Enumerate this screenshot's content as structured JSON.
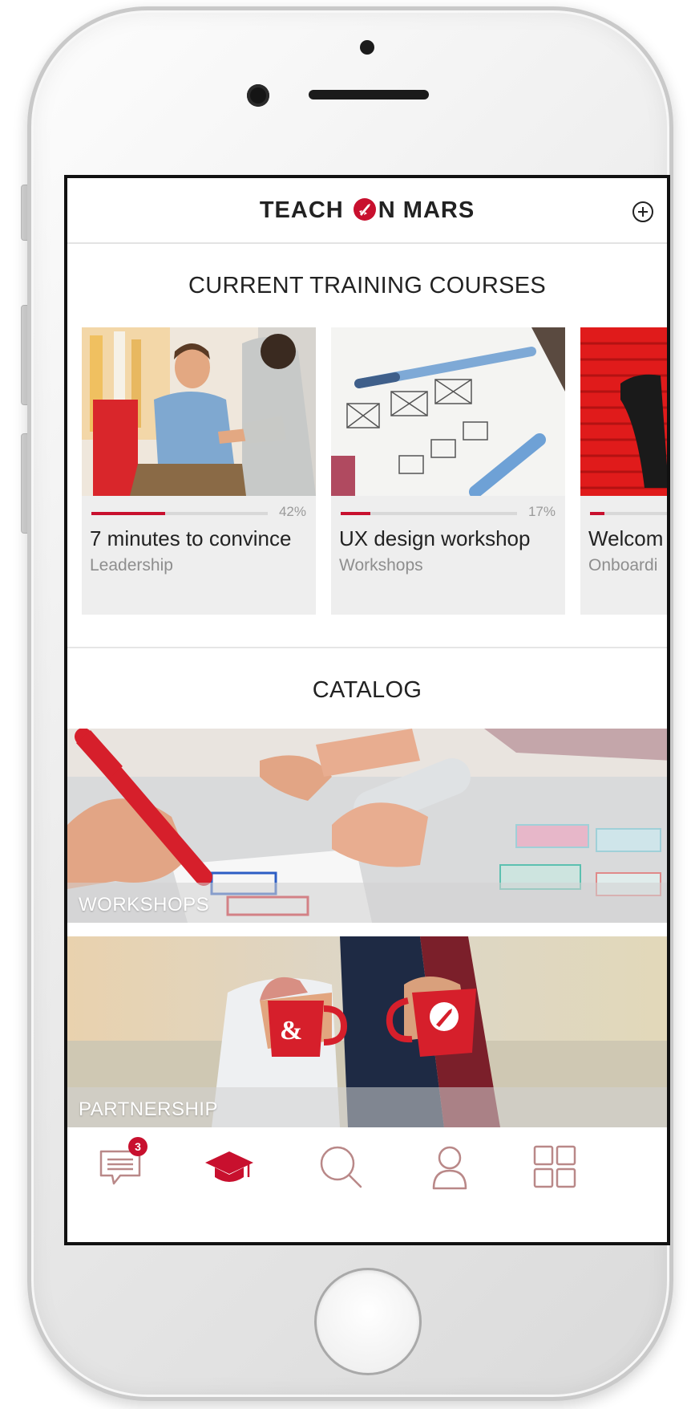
{
  "header": {
    "logo_part1": "TEACH",
    "logo_part2": "N MARS",
    "logo_icon": "rocket-icon",
    "add_icon": "plus-circle-icon"
  },
  "current_section": {
    "title": "CURRENT TRAINING COURSES",
    "courses": [
      {
        "title": "7 minutes to convince",
        "category": "Leadership",
        "progress": 42,
        "progress_label": "42%"
      },
      {
        "title": "UX design workshop",
        "category": "Workshops",
        "progress": 17,
        "progress_label": "17%"
      },
      {
        "title": "Welcom",
        "category": "Onboardi",
        "progress": 8,
        "progress_label": ""
      }
    ]
  },
  "catalog_section": {
    "title": "CATALOG",
    "items": [
      {
        "label": "WORKSHOPS"
      },
      {
        "label": "PARTNERSHIP"
      }
    ]
  },
  "bottom_nav": {
    "items": [
      {
        "icon": "messages-icon",
        "badge": "3"
      },
      {
        "icon": "graduation-cap-icon",
        "active": true
      },
      {
        "icon": "search-icon"
      },
      {
        "icon": "profile-icon"
      },
      {
        "icon": "grid-icon"
      }
    ]
  },
  "colors": {
    "accent": "#c8102e",
    "text": "#222222",
    "secondary_text": "#8e8e8e",
    "inactive_icon": "#b98888"
  }
}
